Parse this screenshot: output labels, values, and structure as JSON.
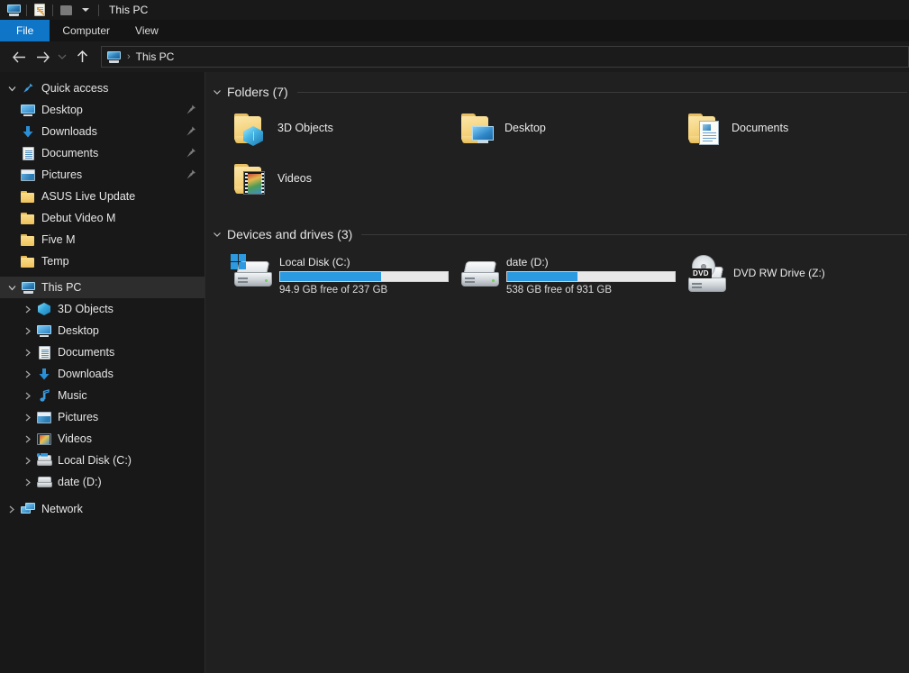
{
  "window": {
    "title": "This PC",
    "quick_access_toolbar": [
      {
        "icon": "this-pc-icon",
        "name": "this-pc"
      },
      {
        "icon": "properties-icon",
        "name": "properties"
      },
      {
        "icon": "new-folder-icon",
        "name": "new-folder"
      },
      {
        "icon": "chevron-down-icon",
        "name": "customize-quick-access"
      }
    ]
  },
  "ribbon": {
    "tabs": [
      {
        "label": "File",
        "active": true
      },
      {
        "label": "Computer",
        "active": false
      },
      {
        "label": "View",
        "active": false
      }
    ]
  },
  "navigation": {
    "back": "←",
    "forward": "→",
    "recent": "⌄",
    "up": "↑",
    "address": {
      "icon": "this-pc-icon",
      "separator": "›",
      "crumb": "This PC"
    }
  },
  "sidebar": {
    "groups": [
      {
        "name": "Quick access",
        "icon": "star-pin-icon",
        "expanded": true,
        "twisty": "chevron-down",
        "items": [
          {
            "label": "Desktop",
            "icon": "desktop-icon",
            "pinned": true,
            "twisty": "none"
          },
          {
            "label": "Downloads",
            "icon": "download-icon",
            "pinned": true,
            "twisty": "none"
          },
          {
            "label": "Documents",
            "icon": "documents-icon",
            "pinned": true,
            "twisty": "none"
          },
          {
            "label": "Pictures",
            "icon": "pictures-icon",
            "pinned": true,
            "twisty": "none"
          },
          {
            "label": "ASUS Live Update",
            "icon": "folder-icon",
            "pinned": false,
            "twisty": "none"
          },
          {
            "label": "Debut Video M",
            "icon": "folder-icon",
            "pinned": false,
            "twisty": "none"
          },
          {
            "label": "Five M",
            "icon": "folder-icon",
            "pinned": false,
            "twisty": "none"
          },
          {
            "label": "Temp",
            "icon": "folder-icon",
            "pinned": false,
            "twisty": "none"
          }
        ]
      },
      {
        "name": "This PC",
        "icon": "this-pc-icon",
        "expanded": true,
        "selected": true,
        "twisty": "chevron-down",
        "items": [
          {
            "label": "3D Objects",
            "icon": "cube-icon",
            "twisty": "chevron-right"
          },
          {
            "label": "Desktop",
            "icon": "desktop-icon",
            "twisty": "chevron-right"
          },
          {
            "label": "Documents",
            "icon": "documents-icon",
            "twisty": "chevron-right"
          },
          {
            "label": "Downloads",
            "icon": "download-icon",
            "twisty": "chevron-right"
          },
          {
            "label": "Music",
            "icon": "music-icon",
            "twisty": "chevron-right"
          },
          {
            "label": "Pictures",
            "icon": "pictures-icon",
            "twisty": "chevron-right"
          },
          {
            "label": "Videos",
            "icon": "videos-icon",
            "twisty": "chevron-right"
          },
          {
            "label": "Local Disk (C:)",
            "icon": "drive-icon",
            "twisty": "chevron-right"
          },
          {
            "label": "date (D:)",
            "icon": "drive-icon",
            "twisty": "chevron-right"
          }
        ]
      },
      {
        "name": "Network",
        "icon": "network-icon",
        "expanded": false,
        "twisty": "chevron-right",
        "items": []
      }
    ]
  },
  "content": {
    "folders_group": {
      "title": "Folders (7)",
      "twisty": "chevron-down",
      "items": [
        {
          "label": "3D Objects",
          "icon": "folder-3d-objects-icon"
        },
        {
          "label": "Desktop",
          "icon": "folder-desktop-icon"
        },
        {
          "label": "Documents",
          "icon": "folder-documents-icon"
        },
        {
          "label": "Videos",
          "icon": "folder-videos-icon"
        }
      ]
    },
    "drives_group": {
      "title": "Devices and drives (3)",
      "twisty": "chevron-down",
      "items": [
        {
          "label": "Local Disk (C:)",
          "icon": "hard-drive-windows-icon",
          "has_bar": true,
          "used_percent": 60,
          "capacity_text": "94.9 GB free of 237 GB"
        },
        {
          "label": "date (D:)",
          "icon": "hard-drive-icon",
          "has_bar": true,
          "used_percent": 42,
          "capacity_text": "538 GB free of 931 GB"
        },
        {
          "label": "DVD RW Drive (Z:)",
          "icon": "dvd-drive-icon",
          "has_bar": false,
          "badge": "DVD",
          "capacity_text": ""
        }
      ]
    }
  },
  "colors": {
    "accent": "#0e75c7",
    "progress_fill": "#2b9ae0",
    "progress_track": "#e8e8e8",
    "folder_yellow": "#f2cd6b",
    "sidebar_bg": "#181818",
    "content_bg": "#202020"
  }
}
